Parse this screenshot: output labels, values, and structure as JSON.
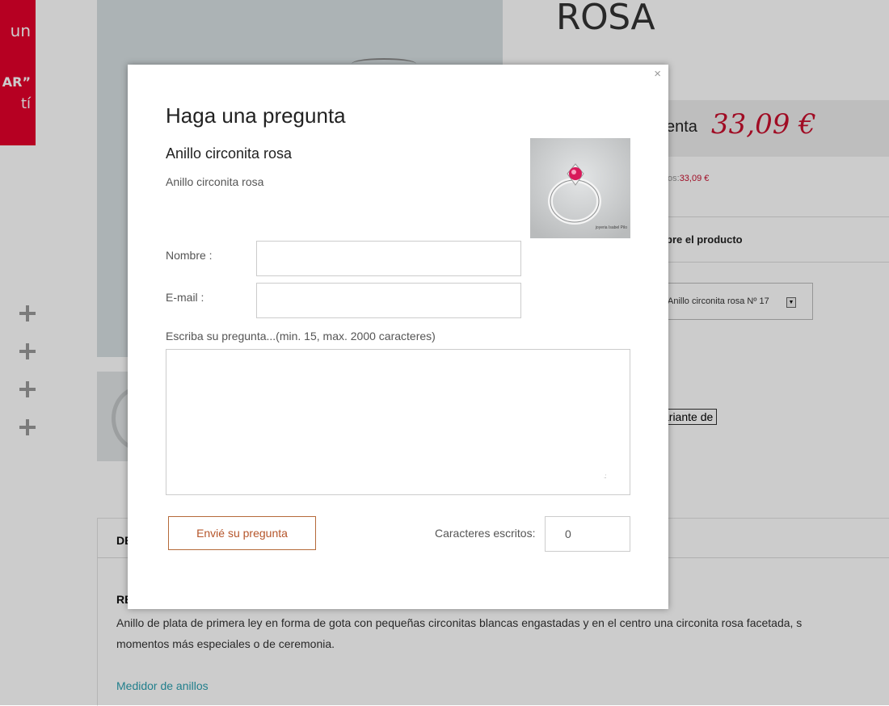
{
  "background": {
    "promo_lines": [
      "un",
      "AR”",
      "tí"
    ],
    "product_title": "ROSA",
    "price_label": "enta",
    "price_value": "33,09 €",
    "price_small_prefix": "os:",
    "price_small_value": "33,09 €",
    "about_label": "bre el producto",
    "variant_selected": "Anillo circonita rosa Nº 17",
    "variant_button": "ariante de",
    "description_tab": "DE",
    "description_ref": "RE",
    "description_text_1": "Anillo de plata de primera ley en forma de gota con pequeñas circonitas blancas engastadas y en el centro una circonita rosa facetada, s",
    "description_text_2": "momentos más especiales o de ceremonia.",
    "ring_measure_link": "Medidor de anillos",
    "colors": {
      "accent_red": "#c8102e",
      "promo_red": "#e4002b",
      "link": "#2a9fb0",
      "button_border": "#b56a3a"
    }
  },
  "modal": {
    "close_label": "×",
    "title": "Haga una pregunta",
    "product_name": "Anillo circonita rosa",
    "product_description": "Anillo circonita rosa",
    "product_image_watermark": "joyeria Isabel Pilo",
    "name_label": "Nombre :",
    "name_value": "",
    "email_label": "E-mail :",
    "email_value": "",
    "question_label": "Escriba su pregunta...(min. 15, max. 2000 caracteres)",
    "question_value": "",
    "submit_label": "Envié su pregunta",
    "chars_label": "Caracteres escritos:",
    "chars_count": "0"
  }
}
